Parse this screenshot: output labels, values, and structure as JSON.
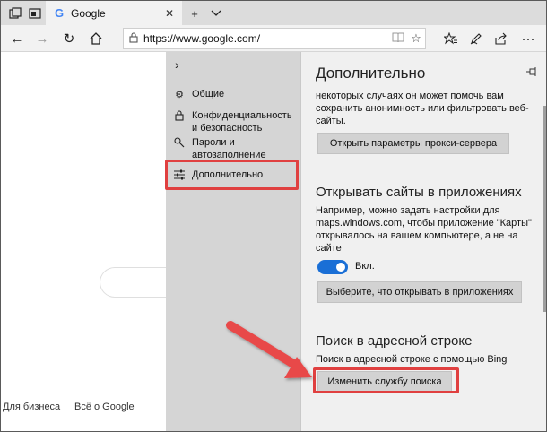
{
  "tab": {
    "title": "Google",
    "logo": "G"
  },
  "address_bar": {
    "url": "https://www.google.com/"
  },
  "page": {
    "footer_links": [
      "Для бизнеса",
      "Всё о Google"
    ]
  },
  "settings_nav": {
    "items": [
      {
        "label": "Общие",
        "icon": "gear-icon"
      },
      {
        "label": "Конфиденциальность и безопасность",
        "icon": "lock-icon"
      },
      {
        "label": "Пароли и автозаполнение",
        "icon": "key-icon"
      },
      {
        "label": "Дополнительно",
        "icon": "sliders-icon"
      }
    ],
    "selected": "Дополнительно"
  },
  "settings_content": {
    "title": "Дополнительно",
    "proxy_text": "некоторых случаях он может помочь вам сохранить анонимность или фильтровать веб-сайты.",
    "proxy_button": "Открыть параметры прокси-сервера",
    "apps_title": "Открывать сайты в приложениях",
    "apps_text": "Например, можно задать настройки для maps.windows.com, чтобы приложение \"Карты\" открывалось на вашем компьютере, а не на сайте",
    "toggle_label": "Вкл.",
    "toggle_on": true,
    "apps_button": "Выберите, что открывать в приложениях",
    "search_title": "Поиск в адресной строке",
    "search_text": "Поиск в адресной строке с помощью Bing",
    "search_button": "Изменить службу поиска"
  },
  "colors": {
    "highlight": "#e04040",
    "toggle_on": "#1a6fd6",
    "arrow": "#e84a4a"
  }
}
